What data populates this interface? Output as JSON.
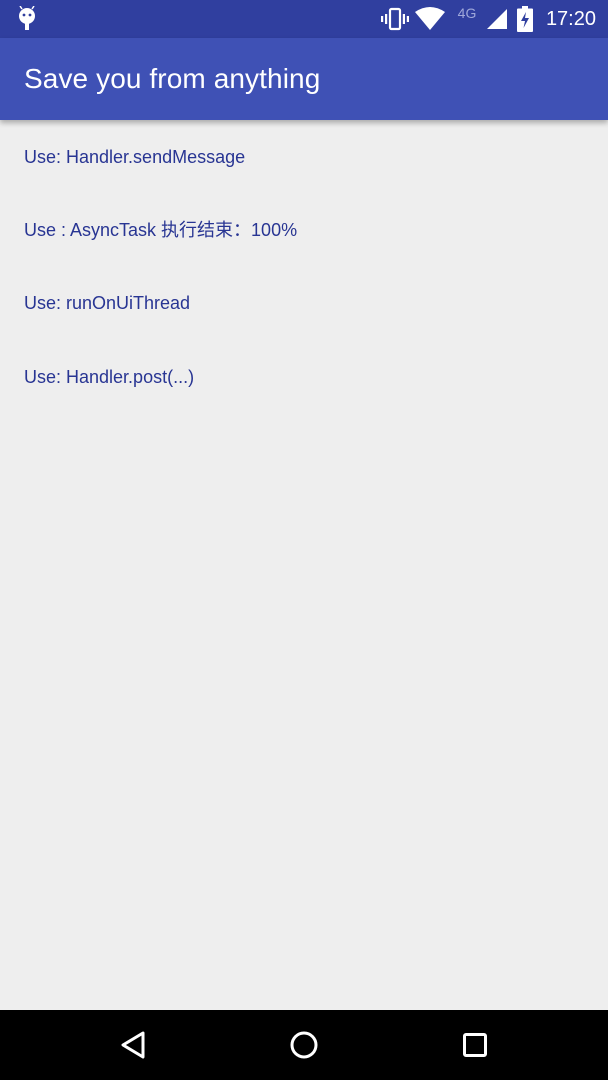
{
  "status_bar": {
    "time": "17:20",
    "network": "4G",
    "icons": [
      "android-notification-icon",
      "vibrate-icon",
      "wifi-icon",
      "signal-icon",
      "battery-charging-icon"
    ]
  },
  "app_bar": {
    "title": "Save you from anything"
  },
  "messages": [
    "Use: Handler.sendMessage",
    "Use : AsyncTask 执行结束：100%",
    "Use: runOnUiThread",
    "Use: Handler.post(...)"
  ],
  "nav_bar": {
    "buttons": [
      "back",
      "home",
      "recents"
    ]
  },
  "colors": {
    "status_bar": "#303f9f",
    "app_bar": "#3f51b5",
    "background": "#eeeeee",
    "text": "#283593"
  }
}
